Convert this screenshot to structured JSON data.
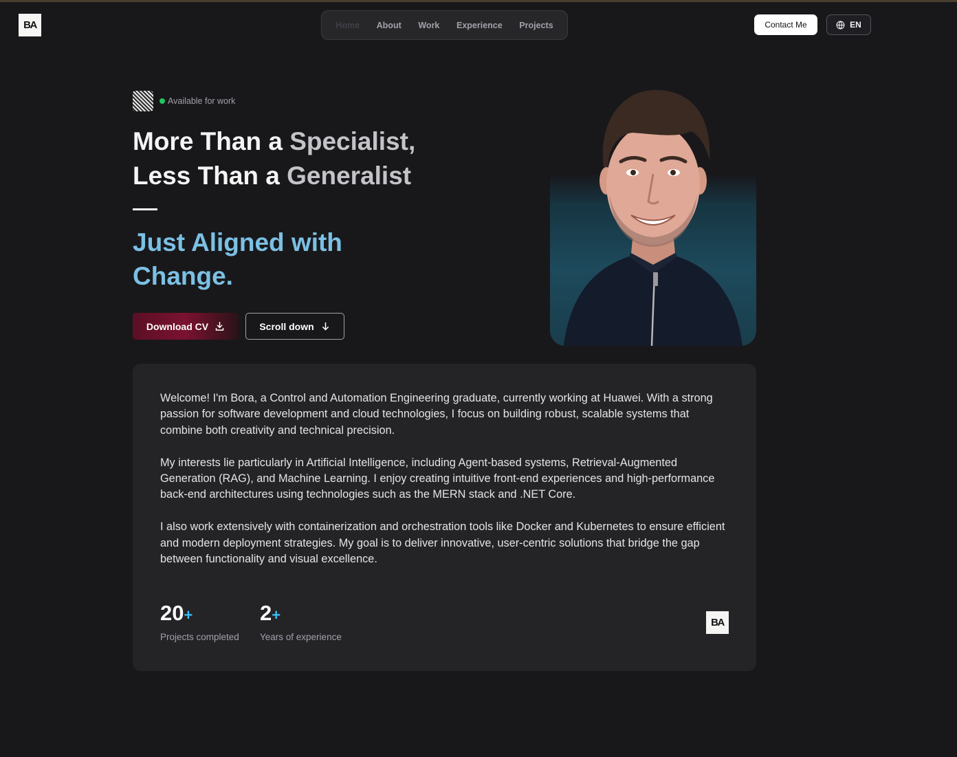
{
  "header": {
    "logo": "BA",
    "nav": [
      "Home",
      "About",
      "Work",
      "Experience",
      "Projects"
    ],
    "active_nav": "Home",
    "contact_label": "Contact Me",
    "lang_label": "EN"
  },
  "hero": {
    "status": "Available for work",
    "title_line1_a": "More Than a ",
    "title_line1_b": "Specialist,",
    "title_line2_a": "Less Than a ",
    "title_line2_b": "Generalist",
    "accent_line1": "Just Aligned with",
    "accent_line2": "Change.",
    "download_label": "Download CV",
    "scroll_label": "Scroll down"
  },
  "about": {
    "paragraphs": [
      "Welcome! I'm Bora, a Control and Automation Engineering graduate, currently working at Huawei. With a strong passion for software development and cloud technologies, I focus on building robust, scalable systems that combine both creativity and technical precision.",
      "My interests lie particularly in Artificial Intelligence, including Agent-based systems, Retrieval-Augmented Generation (RAG), and Machine Learning. I enjoy creating intuitive front-end experiences and high-performance back-end architectures using technologies such as the MERN stack and .NET Core.",
      "I also work extensively with containerization and orchestration tools like Docker and Kubernetes to ensure efficient and modern deployment strategies. My goal is to deliver innovative, user-centric solutions that bridge the gap between functionality and visual excellence."
    ],
    "stats": [
      {
        "value": "20",
        "suffix": "+",
        "label": "Projects completed"
      },
      {
        "value": "2",
        "suffix": "+",
        "label": "Years of experience"
      }
    ],
    "logo": "BA"
  },
  "colors": {
    "background": "#18181b",
    "accent_blue": "#7cc0e4",
    "plus_blue": "#38bdf8",
    "status_green": "#22c55e",
    "cv_button": "#7a1230"
  }
}
